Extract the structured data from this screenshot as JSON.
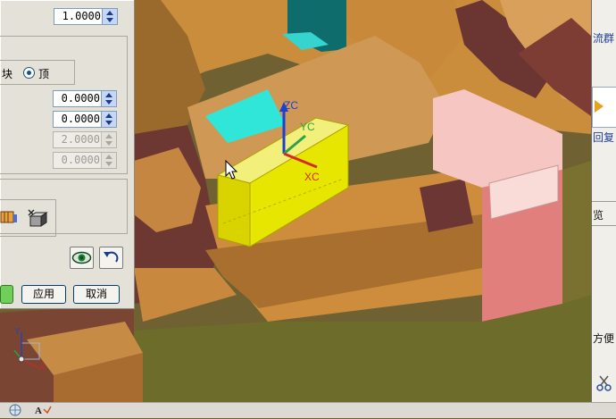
{
  "dialog": {
    "top_value": "1.0000",
    "radio_left_label": "块",
    "radio_right_label": "顶",
    "offset_values": [
      "0.0000",
      "0.0000",
      "2.0000",
      "0.0000"
    ],
    "apply_label": "应用",
    "cancel_label": "取消"
  },
  "axes": {
    "zc": "ZC",
    "yc": "YC",
    "xc": "XC"
  },
  "triad": {
    "x_label": "X",
    "y_label": "Y"
  },
  "right_panel": {
    "text1": "流群",
    "text2": "回复",
    "text3": "览",
    "text4": "方便"
  },
  "colors": {
    "selection": "#e6e600",
    "accent": "#1c3b8d"
  }
}
